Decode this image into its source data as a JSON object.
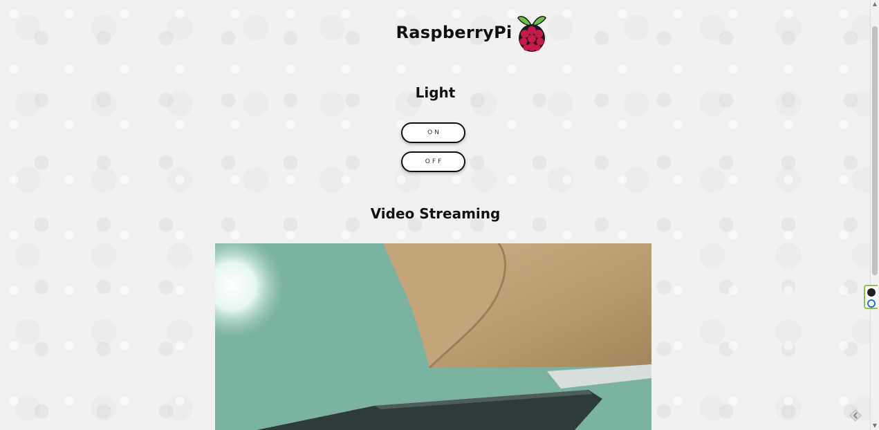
{
  "header": {
    "title": "RaspberryPi",
    "logo_icon": "raspberry-icon"
  },
  "light": {
    "heading": "Light",
    "on_label": "ON",
    "off_label": "OFF"
  },
  "video": {
    "heading": "Video Streaming"
  },
  "colors": {
    "raspberry": "#c51a4a",
    "leaf": "#6cc04a",
    "button_border": "#111111"
  },
  "extension": {
    "close_icon": "close-icon",
    "logo_icon": "extension-logo-icon"
  }
}
